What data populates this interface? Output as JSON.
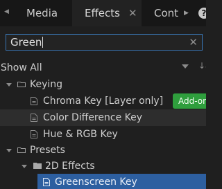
{
  "tabs": {
    "media": "Media",
    "effects": "Effects",
    "effects_close": "✕",
    "cont": "Cont",
    "help": "?"
  },
  "search": {
    "value": "Green",
    "clear": "✕"
  },
  "filter": {
    "label": "Show All",
    "sort_icon": "↓a"
  },
  "tree": {
    "keying": "Keying",
    "chroma": "Chroma Key [Layer only]",
    "addon": "Add-on",
    "color_diff": "Color Difference Key",
    "hue_rgb": "Hue & RGB Key",
    "presets": "Presets",
    "effects2d": "2D Effects",
    "greenscreen": "Greenscreen Key"
  }
}
